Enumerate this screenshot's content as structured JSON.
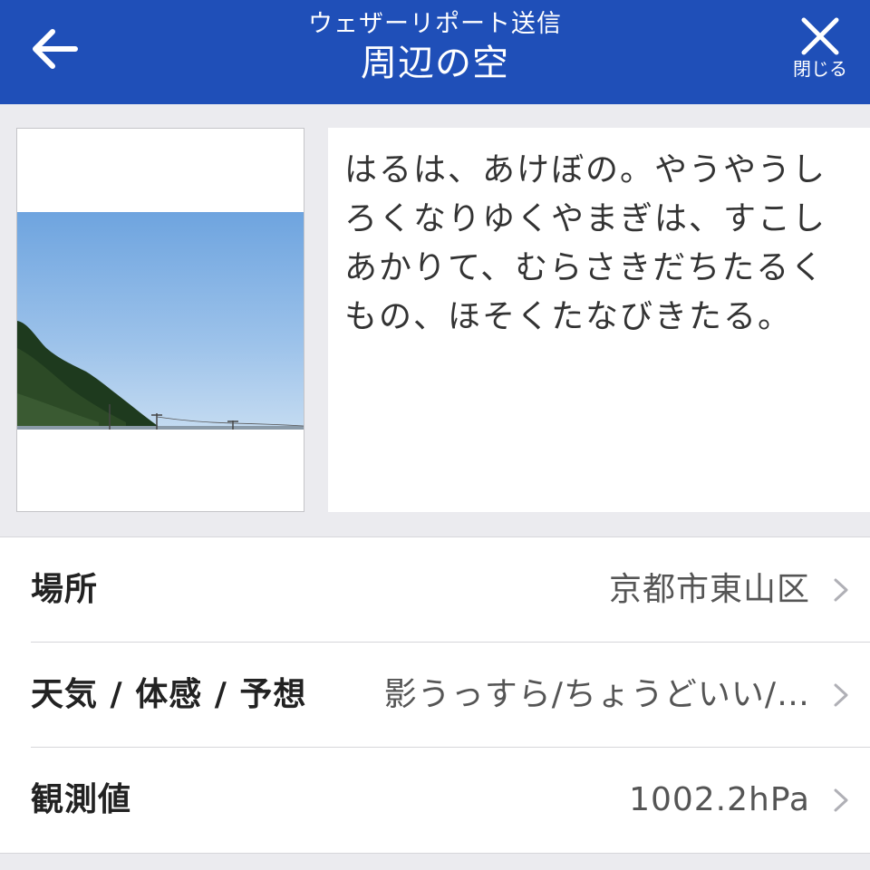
{
  "header": {
    "subtitle": "ウェザーリポート送信",
    "title": "周辺の空",
    "close_label": "閉じる",
    "back_icon": "arrow-left-icon",
    "close_icon": "close-icon",
    "background_color": "#1f4fb8"
  },
  "report": {
    "comment": "はるは、あけぼの。やうやうしろくなりゆくやまぎは、すこしあかりて、むらさきだちたるくもの、ほそくたなびきたる。"
  },
  "details": {
    "location": {
      "label": "場所",
      "value": "京都市東山区"
    },
    "weather": {
      "label": "天気 / 体感 / 予想",
      "value": "影うっすら/ちょうどいい/…"
    },
    "observation": {
      "label": "観測値",
      "value": "1002.2hPa"
    }
  }
}
